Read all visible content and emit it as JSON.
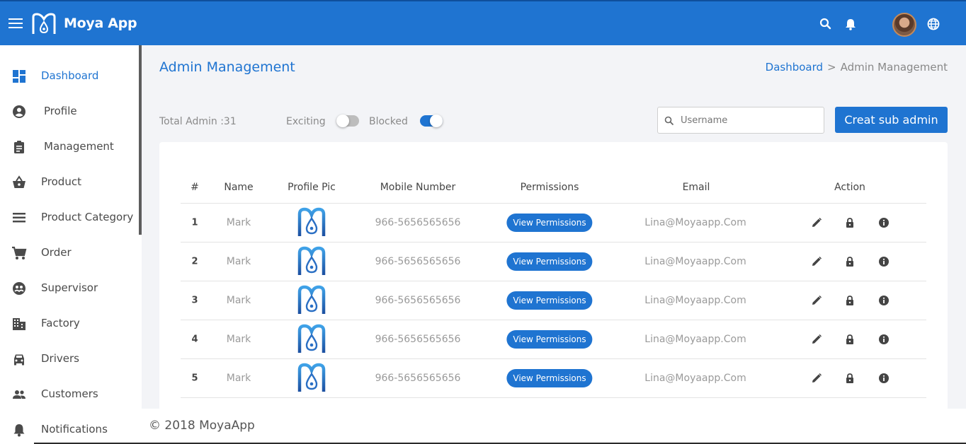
{
  "app": {
    "brand": "Moya App",
    "primary_color": "#1f74d1"
  },
  "topbar_icons": [
    "search-icon",
    "bell-icon",
    "moon-icon",
    "avatar",
    "globe-icon"
  ],
  "sidebar": {
    "items": [
      {
        "label": "Dashboard",
        "icon": "dashboard-icon",
        "active": true
      },
      {
        "label": "Profile",
        "icon": "account-circle-icon"
      },
      {
        "label": "Management",
        "icon": "clipboard-icon"
      },
      {
        "label": "Product",
        "icon": "basket-icon"
      },
      {
        "label": "Product Category",
        "icon": "list-icon"
      },
      {
        "label": "Order",
        "icon": "cart-icon"
      },
      {
        "label": "Supervisor",
        "icon": "supervisor-icon"
      },
      {
        "label": "Factory",
        "icon": "building-icon"
      },
      {
        "label": "Drivers",
        "icon": "car-icon"
      },
      {
        "label": "Customers",
        "icon": "people-icon"
      },
      {
        "label": "Notifications",
        "icon": "bell-icon"
      }
    ]
  },
  "page": {
    "title": "Admin Management",
    "breadcrumb": {
      "link": "Dashboard",
      "separator": ">",
      "current": "Admin Management"
    }
  },
  "toolbar": {
    "total_admin": "Total Admin :31",
    "exciting_label": "Exciting",
    "exciting_on": false,
    "blocked_label": "Blocked",
    "blocked_on": true,
    "search_placeholder": "Username",
    "create_button": "Creat sub admin"
  },
  "table": {
    "headers": [
      "#",
      "Name",
      "Profile Pic",
      "Mobile Number",
      "Permissions",
      "Email",
      "Action"
    ],
    "permissions_button": "View Permissions",
    "rows": [
      {
        "num": "1",
        "name": "Mark",
        "mobile": "966-5656565656",
        "email": "Lina@Moyaapp.Com"
      },
      {
        "num": "2",
        "name": "Mark",
        "mobile": "966-5656565656",
        "email": "Lina@Moyaapp.Com"
      },
      {
        "num": "3",
        "name": "Mark",
        "mobile": "966-5656565656",
        "email": "Lina@Moyaapp.Com"
      },
      {
        "num": "4",
        "name": "Mark",
        "mobile": "966-5656565656",
        "email": "Lina@Moyaapp.Com"
      },
      {
        "num": "5",
        "name": "Mark",
        "mobile": "966-5656565656",
        "email": "Lina@Moyaapp.Com"
      }
    ]
  },
  "footer": {
    "text": "© 2018 MoyaApp"
  }
}
